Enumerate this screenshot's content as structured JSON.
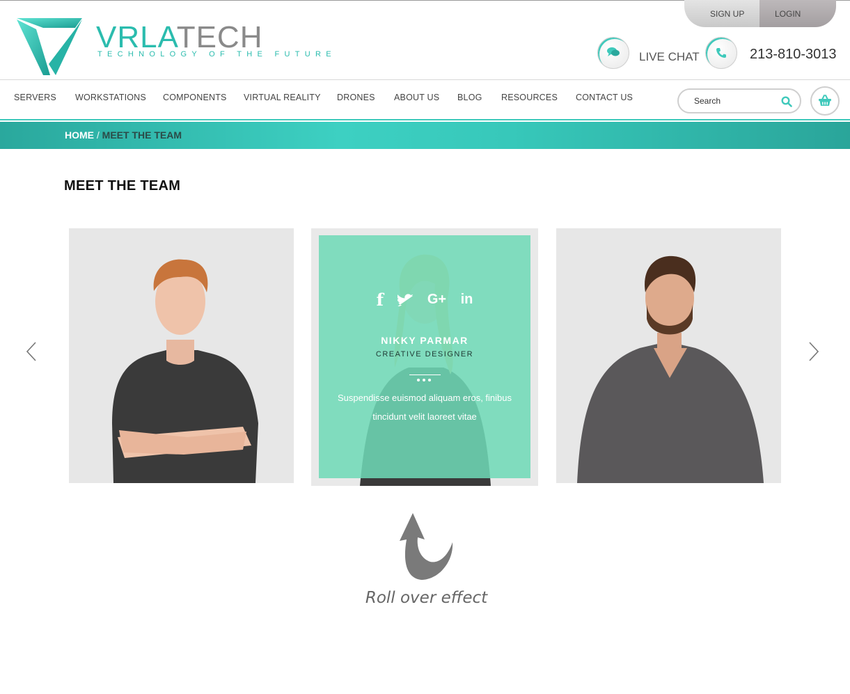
{
  "header": {
    "brand_part1": "VRLA",
    "brand_part2": "TECH",
    "tagline": "TECHNOLOGY OF THE FUTURE",
    "signup_label": "SIGN UP",
    "login_label": "LOGIN",
    "live_chat_label": "LIVE CHAT",
    "phone_number": "213-810-3013"
  },
  "nav": {
    "items": [
      "SERVERS",
      "WORKSTATIONS",
      "COMPONENTS",
      "VIRTUAL REALITY",
      "DRONES",
      "ABOUT US",
      "BLOG",
      "RESOURCES",
      "CONTACT US"
    ],
    "search_placeholder": "Search"
  },
  "breadcrumb": {
    "home": "HOME",
    "separator": " / ",
    "current": "MEET THE TEAM"
  },
  "page": {
    "title": "MEET THE TEAM"
  },
  "team": {
    "featured": {
      "name": "NIKKY PARMAR",
      "role": "CREATIVE DESIGNER",
      "bio": "Suspendisse euismod aliquam eros, finibus tincidunt velit laoreet vitae",
      "socials": [
        "f",
        "twitter-icon",
        "G+",
        "in"
      ]
    }
  },
  "annotation": {
    "text": "Roll over effect"
  },
  "colors": {
    "accent": "#3dd0c2",
    "overlay": "#6fdab7",
    "brand_gray": "#8a8a8a"
  }
}
